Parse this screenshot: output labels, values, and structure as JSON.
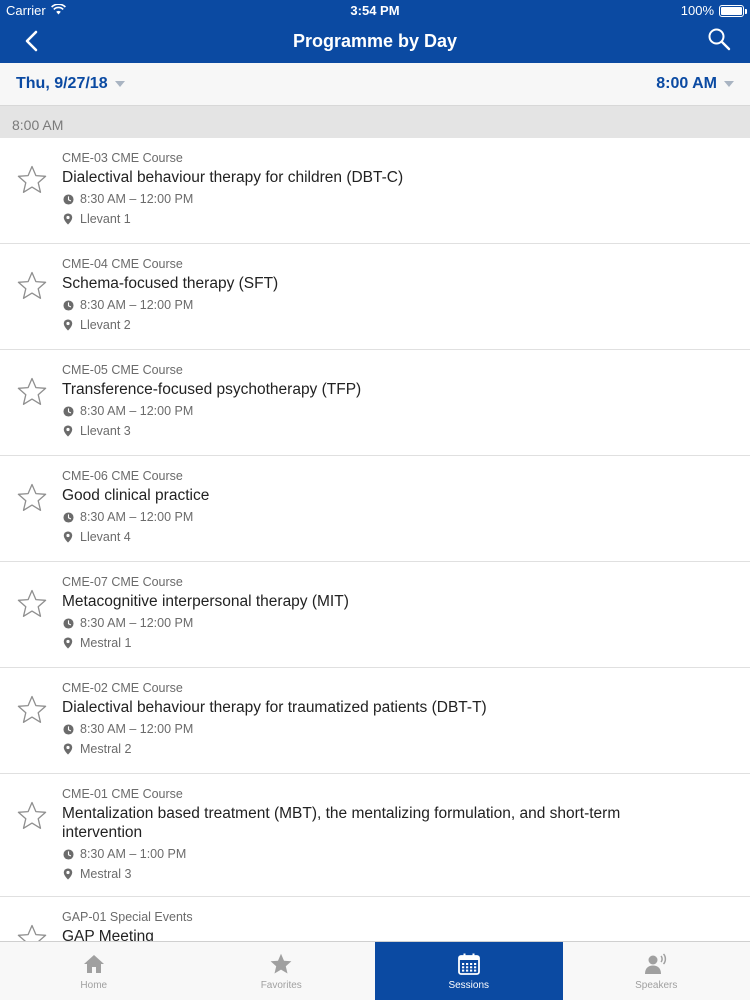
{
  "status_bar": {
    "carrier": "Carrier",
    "time": "3:54 PM",
    "battery": "100%",
    "battery_level": 1.0
  },
  "nav": {
    "title": "Programme by Day",
    "back_icon": "chevron-left-icon",
    "search_icon": "search-icon"
  },
  "filter": {
    "date": "Thu, 9/27/18",
    "time": "8:00 AM"
  },
  "section": {
    "label": "8:00 AM"
  },
  "sessions": [
    {
      "code": "CME-03 CME Course",
      "title": "Dialectival behaviour therapy for children (DBT-C)",
      "time": "8:30 AM – 12:00 PM",
      "location": "Llevant 1"
    },
    {
      "code": "CME-04 CME Course",
      "title": "Schema-focused therapy (SFT)",
      "time": "8:30 AM – 12:00 PM",
      "location": "Llevant 2"
    },
    {
      "code": "CME-05 CME Course",
      "title": "Transference-focused psychotherapy (TFP)",
      "time": "8:30 AM – 12:00 PM",
      "location": "Llevant 3"
    },
    {
      "code": "CME-06 CME Course",
      "title": "Good clinical practice",
      "time": "8:30 AM – 12:00 PM",
      "location": "Llevant 4"
    },
    {
      "code": "CME-07 CME Course",
      "title": "Metacognitive interpersonal therapy (MIT)",
      "time": "8:30 AM – 12:00 PM",
      "location": "Mestral 1"
    },
    {
      "code": "CME-02 CME Course",
      "title": "Dialectival behaviour therapy for traumatized patients (DBT-T)",
      "time": "8:30 AM – 12:00 PM",
      "location": "Mestral 2"
    },
    {
      "code": "CME-01 CME Course",
      "title": "Mentalization based treatment (MBT), the mentalizing formulation, and short-term intervention",
      "time": "8:30 AM – 1:00 PM",
      "location": "Mestral 3"
    },
    {
      "code": "GAP-01 Special Events",
      "title": "GAP Meeting",
      "time": "",
      "location": ""
    }
  ],
  "tabs": [
    {
      "label": "Home",
      "icon": "home-icon",
      "active": false
    },
    {
      "label": "Favorites",
      "icon": "star-icon",
      "active": false
    },
    {
      "label": "Sessions",
      "icon": "calendar-icon",
      "active": true
    },
    {
      "label": "Speakers",
      "icon": "speaker-icon",
      "active": false
    }
  ],
  "colors": {
    "brand": "#0b4aa2",
    "section_bg": "#e4e4e4",
    "tab_inactive": "#a0a0a0"
  }
}
